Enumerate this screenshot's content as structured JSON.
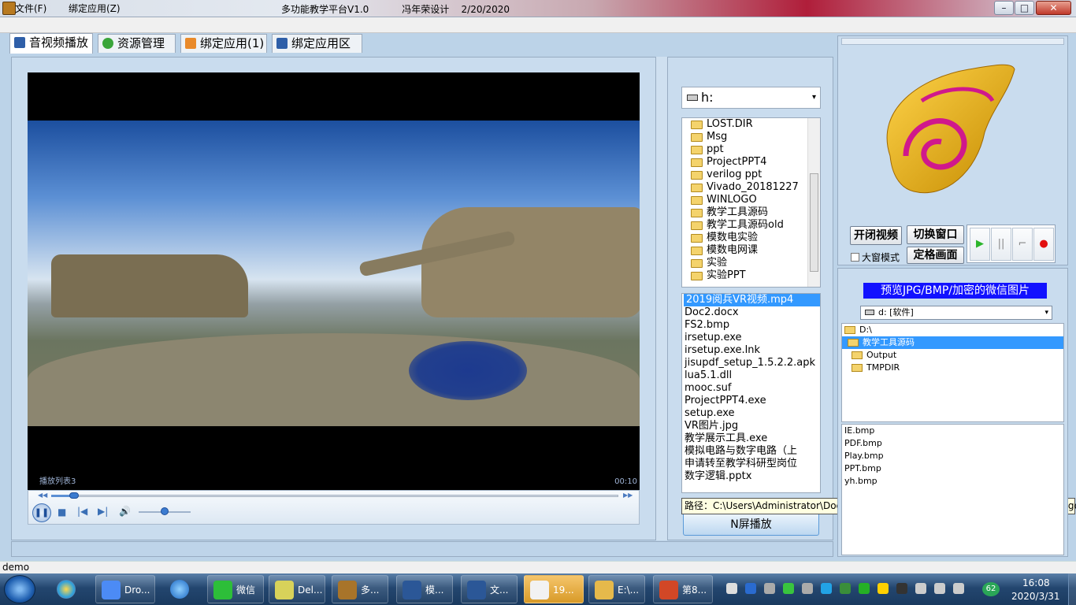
{
  "window": {
    "title": "多功能教学平台V1.0           冯年荣设计    2/20/2020",
    "minimize_glyph": "–",
    "maximize_glyph": "□",
    "close_glyph": "✕"
  },
  "menu": {
    "file": "文件(F)",
    "bind": "绑定应用(Z)"
  },
  "tabs": [
    {
      "label": "音视频播放"
    },
    {
      "label": "资源管理"
    },
    {
      "label": "绑定应用(1)"
    },
    {
      "label": "绑定应用区"
    }
  ],
  "video": {
    "playlist_label": "播放列表3",
    "time": "00:10",
    "seek_back_glyph": "◀◀",
    "seek_fwd_glyph": "▶▶",
    "seek_position": 0.04,
    "volume": 0.5,
    "pause_glyph": "❚❚",
    "stop_glyph": "■",
    "prev_glyph": "|◀",
    "next_glyph": "▶|",
    "volume_glyph": "🔊"
  },
  "drive": {
    "value": "h:",
    "arrow": "▾"
  },
  "folders": [
    "LOST.DIR",
    "Msg",
    "ppt",
    "ProjectPPT4",
    "verilog ppt",
    "Vivado_20181227",
    "WINLOGO",
    "教学工具源码",
    "教学工具源码old",
    "模数电实验",
    "模数电网课",
    "实验",
    "实验PPT"
  ],
  "files": [
    {
      "name": "2019阅兵VR视频.mp4",
      "selected": true
    },
    {
      "name": "Doc2.docx"
    },
    {
      "name": "FS2.bmp"
    },
    {
      "name": "irsetup.exe"
    },
    {
      "name": "irsetup.exe.lnk"
    },
    {
      "name": "jisupdf_setup_1.5.2.2.apk"
    },
    {
      "name": "lua5.1.dll"
    },
    {
      "name": "mooc.suf"
    },
    {
      "name": "ProjectPPT4.exe"
    },
    {
      "name": "setup.exe"
    },
    {
      "name": "VR图片.jpg"
    },
    {
      "name": "教学展示工具.exe"
    },
    {
      "name": "模拟电路与数字电路（上"
    },
    {
      "name": "申请转至教学科研型岗位"
    },
    {
      "name": "数字逻辑.pptx"
    }
  ],
  "path_tooltip": "路径：C:\\Users\\Administrator\\Documents\\WeChat Files\\你的微信号\\FileStorage\\Image",
  "split_button": "N屏播放",
  "controls": {
    "toggle_video": "开闭视频",
    "switch_window": "切换窗口",
    "large_mode": "大窗模式",
    "freeze": "定格画面",
    "play_glyph": "▶",
    "pause_glyph": "||",
    "stop_glyph": "⌐",
    "record_glyph": "●"
  },
  "preview": {
    "label": "预览JPG/BMP/加密的微信图片",
    "drive": "d: [软件]",
    "arrow": "▾",
    "tree": [
      {
        "label": "D:\\",
        "indent": 0
      },
      {
        "label": "教学工具源码",
        "indent": 1,
        "selected": true
      },
      {
        "label": "Output",
        "indent": 2
      },
      {
        "label": "TMPDIR",
        "indent": 2
      }
    ],
    "images": [
      "IE.bmp",
      "PDF.bmp",
      "Play.bmp",
      "PPT.bmp",
      "yh.bmp"
    ]
  },
  "status": "demo",
  "taskbar": {
    "items": [
      {
        "label": "Dro..."
      },
      {
        "label": "微信"
      },
      {
        "label": "Del..."
      },
      {
        "label": "多..."
      },
      {
        "label": "模..."
      },
      {
        "label": "文..."
      },
      {
        "label": "19..."
      },
      {
        "label": "E:\\..."
      },
      {
        "label": "第8..."
      }
    ],
    "net_badge": "62",
    "time": "16:08",
    "date": "2020/3/31"
  },
  "colors": {
    "selection": "#3399ff",
    "preview_label_bg": "#1212ff",
    "record_red": "#e21010",
    "play_green": "#2bb52b",
    "panel_bg": "#c9dcee"
  }
}
